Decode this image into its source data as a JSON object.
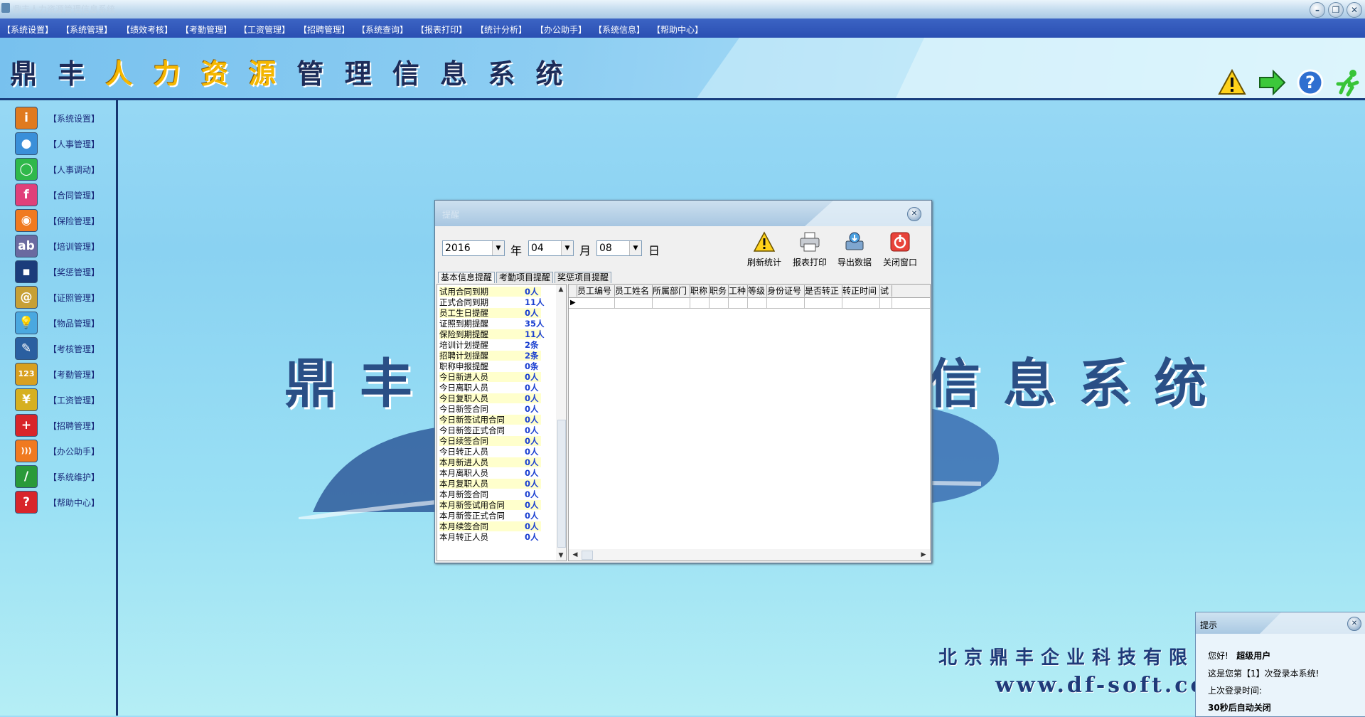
{
  "window": {
    "title": "鼎丰人力资源管理信息系统",
    "controls": [
      "minimize-button",
      "restore-button",
      "close-button"
    ]
  },
  "menu": [
    "【系统设置】",
    "【系统管理】",
    "【绩效考核】",
    "【考勤管理】",
    "【工资管理】",
    "【招聘管理】",
    "【系统查询】",
    "【报表打印】",
    "【统计分析】",
    "【办公助手】",
    "【系统信息】",
    "【帮助中心】"
  ],
  "banner": {
    "title_part1": "鼎 丰 ",
    "title_highlight": "人 力 资 源",
    "title_part2": " 管 理 信 息 系 统",
    "icons": [
      "warning-icon",
      "arrow-right-icon",
      "help-icon",
      "exit-runner-icon"
    ]
  },
  "sidebar": [
    {
      "label": "【系统设置】",
      "icon": "info-icon",
      "glyph": "i",
      "color": "#e07a1f"
    },
    {
      "label": "【人事管理】",
      "icon": "users-icon",
      "glyph": "●",
      "color": "#3a8fd9"
    },
    {
      "label": "【人事调动】",
      "icon": "chat-icon",
      "glyph": "◯",
      "color": "#2fb84a"
    },
    {
      "label": "【合同管理】",
      "icon": "contract-icon",
      "glyph": "f",
      "color": "#e0407a"
    },
    {
      "label": "【保险管理】",
      "icon": "insurance-icon",
      "glyph": "◉",
      "color": "#f07a20"
    },
    {
      "label": "【培训管理】",
      "icon": "training-icon",
      "glyph": "ab",
      "color": "#6a6aa0"
    },
    {
      "label": "【奖惩管理】",
      "icon": "reward-icon",
      "glyph": "▪",
      "color": "#1b3c7b"
    },
    {
      "label": "【证照管理】",
      "icon": "at-icon",
      "glyph": "@",
      "color": "#c7a035"
    },
    {
      "label": "【物品管理】",
      "icon": "bulb-icon",
      "glyph": "💡",
      "color": "#4aa8e0"
    },
    {
      "label": "【考核管理】",
      "icon": "pencil-icon",
      "glyph": "✎",
      "color": "#2a5fa0"
    },
    {
      "label": "【考勤管理】",
      "icon": "numbers-icon",
      "glyph": "123",
      "color": "#d8a020"
    },
    {
      "label": "【工资管理】",
      "icon": "yen-icon",
      "glyph": "¥",
      "color": "#d6b020"
    },
    {
      "label": "【招聘管理】",
      "icon": "cross-icon",
      "glyph": "+",
      "color": "#d8252a"
    },
    {
      "label": "【办公助手】",
      "icon": "rss-icon",
      "glyph": ")))",
      "color": "#f07a20"
    },
    {
      "label": "【系统维护】",
      "icon": "tool-icon",
      "glyph": "/",
      "color": "#2a9a3a"
    },
    {
      "label": "【帮助中心】",
      "icon": "help-book-icon",
      "glyph": "?",
      "color": "#d8252a"
    }
  ],
  "watermark": {
    "left": "鼎丰",
    "right": "信息系统",
    "company": "北京鼎丰企业科技有限",
    "website": "www.df-soft.co"
  },
  "dialog": {
    "title": "提醒",
    "year": "2016",
    "year_unit": "年",
    "month": "04",
    "month_unit": "月",
    "day": "08",
    "day_unit": "日",
    "tools": [
      {
        "label": "刷新统计",
        "icon": "refresh-stats-icon"
      },
      {
        "label": "报表打印",
        "icon": "printer-icon"
      },
      {
        "label": "导出数据",
        "icon": "export-icon"
      },
      {
        "label": "关闭窗口",
        "icon": "power-icon"
      }
    ],
    "tabs": [
      "基本信息提醒",
      "考勤项目提醒",
      "奖惩项目提醒"
    ],
    "reminders": [
      {
        "name": "试用合同到期",
        "count": "0人"
      },
      {
        "name": "正式合同到期",
        "count": "11人"
      },
      {
        "name": "员工生日提醒",
        "count": "0人"
      },
      {
        "name": "证照到期提醒",
        "count": "35人"
      },
      {
        "name": "保险到期提醒",
        "count": "11人"
      },
      {
        "name": "培训计划提醒",
        "count": "2条"
      },
      {
        "name": "招聘计划提醒",
        "count": "2条"
      },
      {
        "name": "职称申报提醒",
        "count": "0条"
      },
      {
        "name": "今日新进人员",
        "count": "0人"
      },
      {
        "name": "今日离职人员",
        "count": "0人"
      },
      {
        "name": "今日复职人员",
        "count": "0人"
      },
      {
        "name": "今日新签合同",
        "count": "0人"
      },
      {
        "name": "今日新签试用合同",
        "count": "0人"
      },
      {
        "name": "今日新签正式合同",
        "count": "0人"
      },
      {
        "name": "今日续签合同",
        "count": "0人"
      },
      {
        "name": "今日转正人员",
        "count": "0人"
      },
      {
        "name": "本月新进人员",
        "count": "0人"
      },
      {
        "name": "本月离职人员",
        "count": "0人"
      },
      {
        "name": "本月复职人员",
        "count": "0人"
      },
      {
        "name": "本月新签合同",
        "count": "0人"
      },
      {
        "name": "本月新签试用合同",
        "count": "0人"
      },
      {
        "name": "本月新签正式合同",
        "count": "0人"
      },
      {
        "name": "本月续签合同",
        "count": "0人"
      },
      {
        "name": "本月转正人员",
        "count": "0人"
      }
    ],
    "grid_columns": [
      "员工编号",
      "员工姓名",
      "所属部门",
      "职称",
      "职务",
      "工种",
      "等级",
      "身份证号",
      "是否转正",
      "转正时间",
      "试"
    ]
  },
  "notification": {
    "title": "提示",
    "greeting": "您好!",
    "user": "超级用户",
    "login_count_line": "这是您第【1】次登录本系统!",
    "last_login_label": "上次登录时间:",
    "auto_close": "30秒后自动关闭"
  },
  "colors": {
    "menu_bg": "#2a4fb2",
    "desktop_bg": "#9fdcf6",
    "highlight_title": "#f5b700",
    "count_blue": "#1a3fd0"
  }
}
